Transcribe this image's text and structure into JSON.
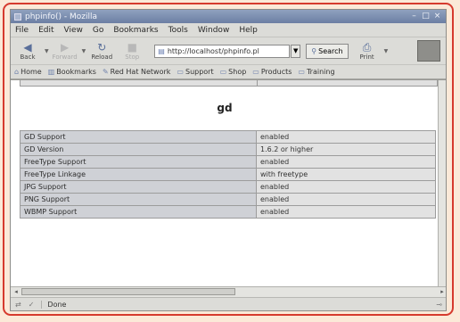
{
  "window": {
    "title": "phpinfo() - Mozilla",
    "controls": [
      "–",
      "□",
      "×"
    ]
  },
  "menu": [
    "File",
    "Edit",
    "View",
    "Go",
    "Bookmarks",
    "Tools",
    "Window",
    "Help"
  ],
  "toolbar": {
    "back_label": "Back",
    "forward_label": "Forward",
    "reload_label": "Reload",
    "stop_label": "Stop",
    "url_value": "http://localhost/phpinfo.pl",
    "search_label": "Search",
    "print_label": "Print"
  },
  "bookmarks": [
    "Home",
    "Bookmarks",
    "Red Hat Network",
    "Support",
    "Shop",
    "Products",
    "Training"
  ],
  "page": {
    "heading": "gd",
    "rows": [
      {
        "key": "GD Support",
        "value": "enabled"
      },
      {
        "key": "GD Version",
        "value": "1.6.2 or higher"
      },
      {
        "key": "FreeType Support",
        "value": "enabled"
      },
      {
        "key": "FreeType Linkage",
        "value": "with freetype"
      },
      {
        "key": "JPG Support",
        "value": "enabled"
      },
      {
        "key": "PNG Support",
        "value": "enabled"
      },
      {
        "key": "WBMP Support",
        "value": "enabled"
      }
    ]
  },
  "status": {
    "text": "Done"
  }
}
